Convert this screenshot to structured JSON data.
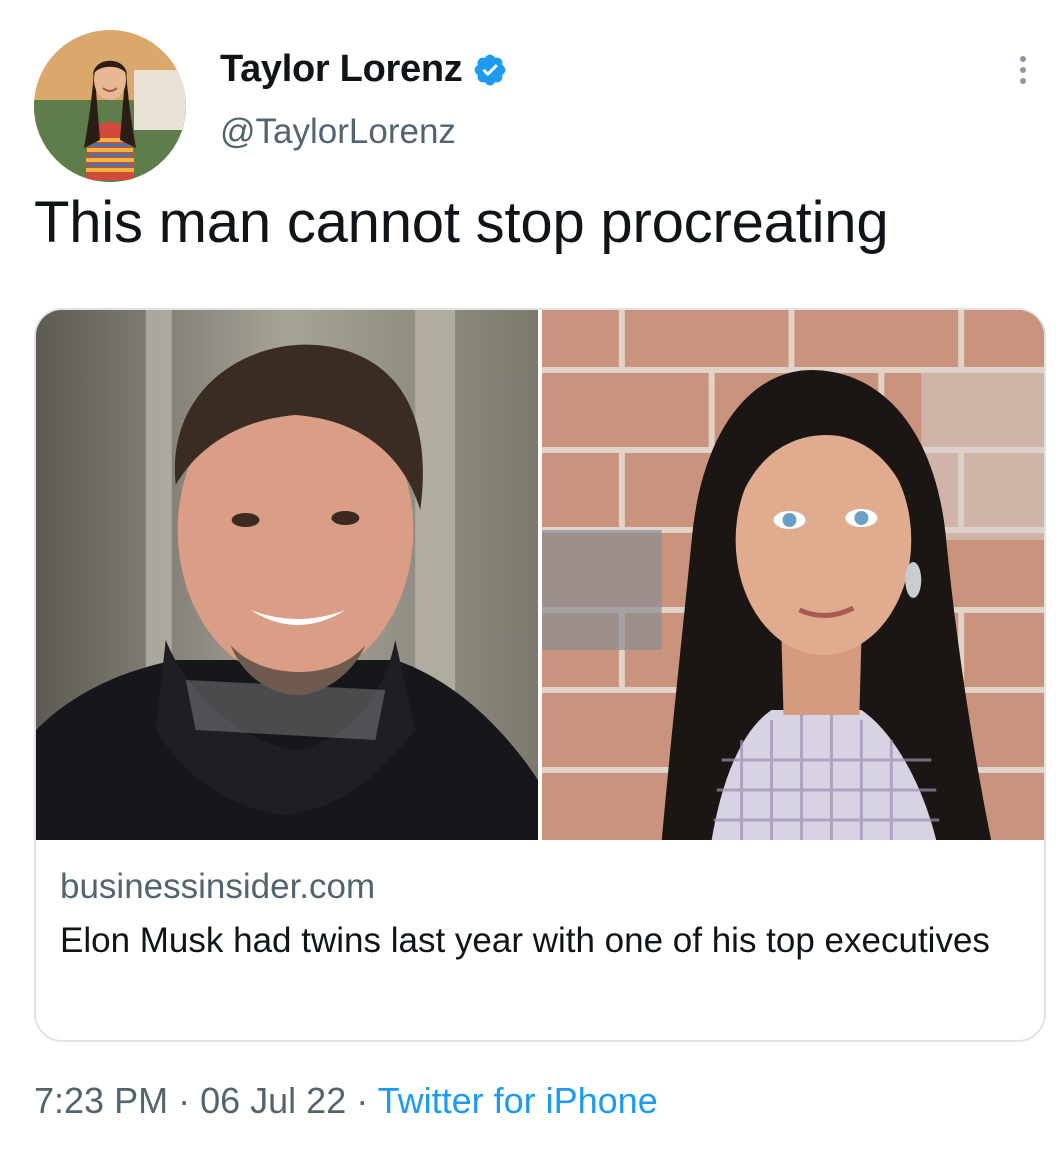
{
  "author": {
    "display_name": "Taylor Lorenz",
    "handle": "@TaylorLorenz",
    "verified": true,
    "avatar_icon": "profile-photo"
  },
  "tweet": {
    "text": "This man cannot stop procreating"
  },
  "card": {
    "domain": "businessinsider.com",
    "title": "Elon Musk had twins last year with one of his top executives",
    "images": [
      "man-smiling-photo",
      "woman-portrait-photo"
    ]
  },
  "meta": {
    "time": "7:23 PM",
    "separator": "·",
    "date": "06 Jul 22",
    "source": "Twitter for iPhone"
  },
  "colors": {
    "accent": "#1d9bf0",
    "secondary_text": "#536471",
    "primary_text": "#0f1419",
    "card_border": "#dfe3e6"
  }
}
